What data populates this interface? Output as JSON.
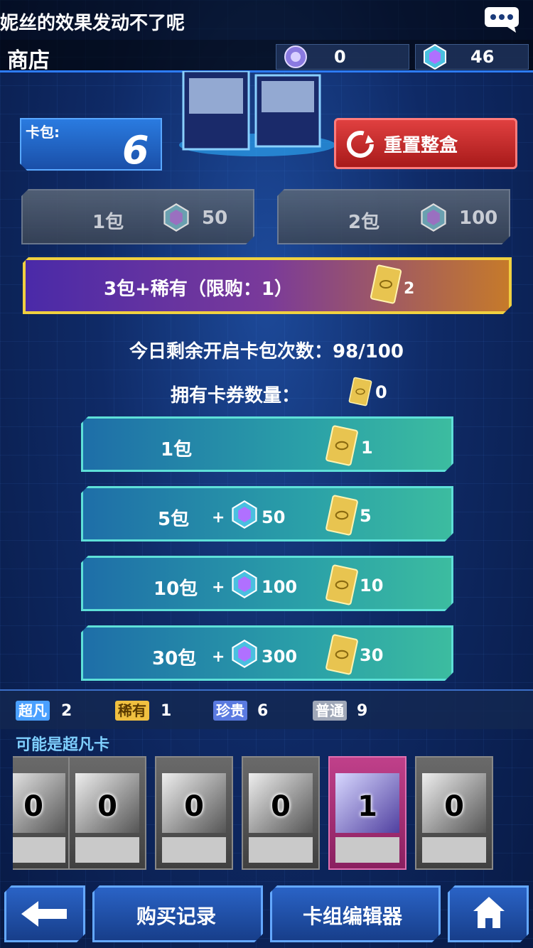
{
  "ticker": {
    "text": "妮丝的效果发动不了呢"
  },
  "header": {
    "title": "商店"
  },
  "currency": {
    "orb_value": "0",
    "gem_value": "46"
  },
  "pack": {
    "label": "卡包:",
    "remaining": "6"
  },
  "reset_button": {
    "label": "重置整盒"
  },
  "gray_buttons": [
    {
      "label": "1包",
      "cost": "50"
    },
    {
      "label": "2包",
      "cost": "100"
    }
  ],
  "rare_button": {
    "label": "3包+稀有（限购：1）",
    "ticket_cost": "2"
  },
  "info": {
    "remaining_opens": "今日剩余开启卡包次数：98/100",
    "tickets_label": "拥有卡券数量：",
    "tickets_count": "0"
  },
  "teal_buttons": [
    {
      "pack": "1包",
      "plus": "",
      "gem": "",
      "ticket": "1"
    },
    {
      "pack": "5包",
      "plus": "+",
      "gem": "50",
      "ticket": "5"
    },
    {
      "pack": "10包",
      "plus": "+",
      "gem": "100",
      "ticket": "10"
    },
    {
      "pack": "30包",
      "plus": "+",
      "gem": "300",
      "ticket": "30"
    }
  ],
  "rarity": [
    {
      "tag": "超凡",
      "count": "2",
      "color": "#4aa0ff"
    },
    {
      "tag": "稀有",
      "count": "1",
      "color": "#f0c040"
    },
    {
      "tag": "珍贵",
      "count": "6",
      "color": "#5a7ae0"
    },
    {
      "tag": "普通",
      "count": "9",
      "color": "#a0a8b8"
    }
  ],
  "possible_label": "可能是超凡卡",
  "cards": [
    {
      "count": "0",
      "style": "normal"
    },
    {
      "count": "0",
      "style": "normal"
    },
    {
      "count": "0",
      "style": "normal"
    },
    {
      "count": "0",
      "style": "normal"
    },
    {
      "count": "1",
      "style": "pink"
    },
    {
      "count": "0",
      "style": "normal"
    }
  ],
  "nav": {
    "history": "购买记录",
    "deck_editor": "卡组编辑器"
  }
}
